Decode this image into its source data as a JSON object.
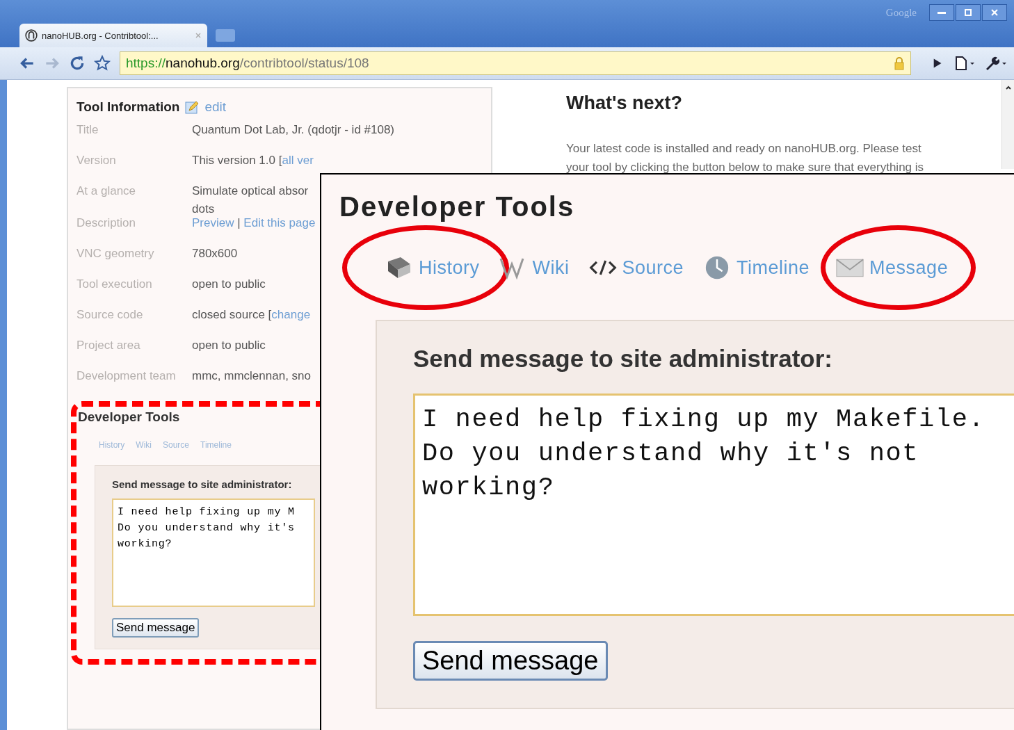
{
  "browser": {
    "brand": "Google",
    "tab_title": "nanoHUB.org - Contribtool:...",
    "url": {
      "scheme": "https://",
      "host": "nanohub.org",
      "path": "/contribtool/status/108"
    }
  },
  "tool_information": {
    "heading": "Tool Information",
    "edit_link": "edit",
    "rows": [
      {
        "label": "Title",
        "value": [
          {
            "text": "Quantum Dot Lab, Jr. (qdotjr - id #108)",
            "link": false
          }
        ]
      },
      {
        "label": "Version",
        "value": [
          {
            "text": "This version 1.0 [",
            "link": false
          },
          {
            "text": "all ver",
            "link": true
          }
        ]
      },
      {
        "label": "At a glance",
        "value": [
          {
            "text": "Simulate optical absor",
            "link": false
          }
        ],
        "more": "dots"
      },
      {
        "label": "Description",
        "value": [
          {
            "text": "Preview",
            "link": true
          },
          {
            "text": " | ",
            "link": false
          },
          {
            "text": "Edit this page",
            "link": true
          }
        ]
      },
      {
        "label": "VNC geometry",
        "value": [
          {
            "text": "780x600",
            "link": false
          }
        ]
      },
      {
        "label": "Tool execution",
        "value": [
          {
            "text": "open to public",
            "link": false
          }
        ]
      },
      {
        "label": "Source code",
        "value": [
          {
            "text": "closed source [",
            "link": false
          },
          {
            "text": "change",
            "link": true
          }
        ]
      },
      {
        "label": "Project area",
        "value": [
          {
            "text": "open to public",
            "link": false
          }
        ]
      },
      {
        "label": "Development team",
        "value": [
          {
            "text": "mmc, mmclennan, sno",
            "link": false
          }
        ]
      }
    ]
  },
  "developer_tools_small": {
    "highlighted": true,
    "title": "Developer Tools",
    "tabs": [
      {
        "label": "History"
      },
      {
        "label": "Wiki"
      },
      {
        "label": "Source"
      },
      {
        "label": "Timeline"
      }
    ],
    "prompt": "Send message to site administrator:",
    "message_lines": [
      "I need help fixing up my M",
      "Do you understand why it's",
      "working?"
    ],
    "button": "Send message"
  },
  "whats_next": {
    "heading": "What's next?",
    "paragraph_lines": [
      "Your latest code is installed and ready on nanoHUB.org. Please test",
      "your tool by clicking the button below to make sure that everything is"
    ]
  },
  "developer_tools_zoom": {
    "title": "Developer Tools",
    "tabs": [
      {
        "label": "History",
        "kind": "book",
        "highlighted": true
      },
      {
        "label": "Wiki",
        "kind": "w",
        "highlighted": false
      },
      {
        "label": "Source",
        "kind": "code",
        "highlighted": false
      },
      {
        "label": "Timeline",
        "kind": "clock",
        "highlighted": false
      },
      {
        "label": "Message",
        "kind": "envelope",
        "highlighted": true
      }
    ],
    "prompt": "Send message to site administrator:",
    "message": "I need help fixing up my Makefile.\nDo you understand why it's not\nworking?",
    "button": "Send message"
  }
}
